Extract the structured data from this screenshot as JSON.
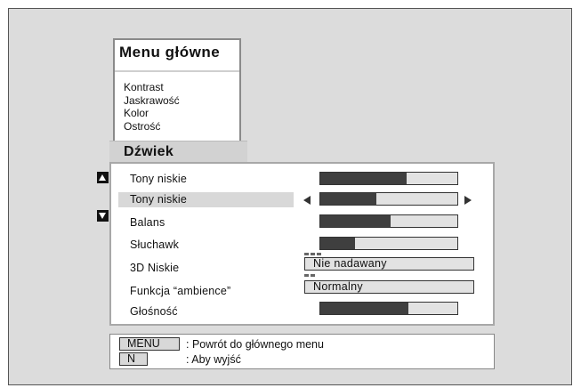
{
  "main_menu": {
    "title": "Menu główne",
    "items": [
      "Kontrast",
      "Jaskrawość",
      "Kolor",
      "Ostrość"
    ]
  },
  "sound_menu": {
    "title": "Dźwiek",
    "rows": [
      {
        "label": "Tony niskie",
        "level": 0.63
      },
      {
        "label": "Tony niskie",
        "level": 0.41,
        "selected": true
      },
      {
        "label": "Balans",
        "level": 0.51
      },
      {
        "label": "Słuchawk",
        "level": 0.25
      },
      {
        "label": "3D  Niskie",
        "value": "Nie nadawany"
      },
      {
        "label": "Funkcja “ambience”",
        "value": "Normalny"
      },
      {
        "label": "Głośność",
        "level": 0.64
      }
    ]
  },
  "footer": {
    "menu_key": "MENU",
    "menu_text": ": Powrót do głównego menu",
    "n_key": "N",
    "n_text": ": Aby wyjść"
  },
  "colors": {
    "background": "#dcdcdc",
    "bar_fill": "#3f3f3f",
    "bar_empty": "#e2e2e2",
    "highlight": "#d8d8d8"
  },
  "icons": {
    "scroll_up": "up-triangle-icon",
    "scroll_down": "down-triangle-icon",
    "adjust_left": "left-arrow-icon",
    "adjust_right": "right-arrow-icon"
  }
}
